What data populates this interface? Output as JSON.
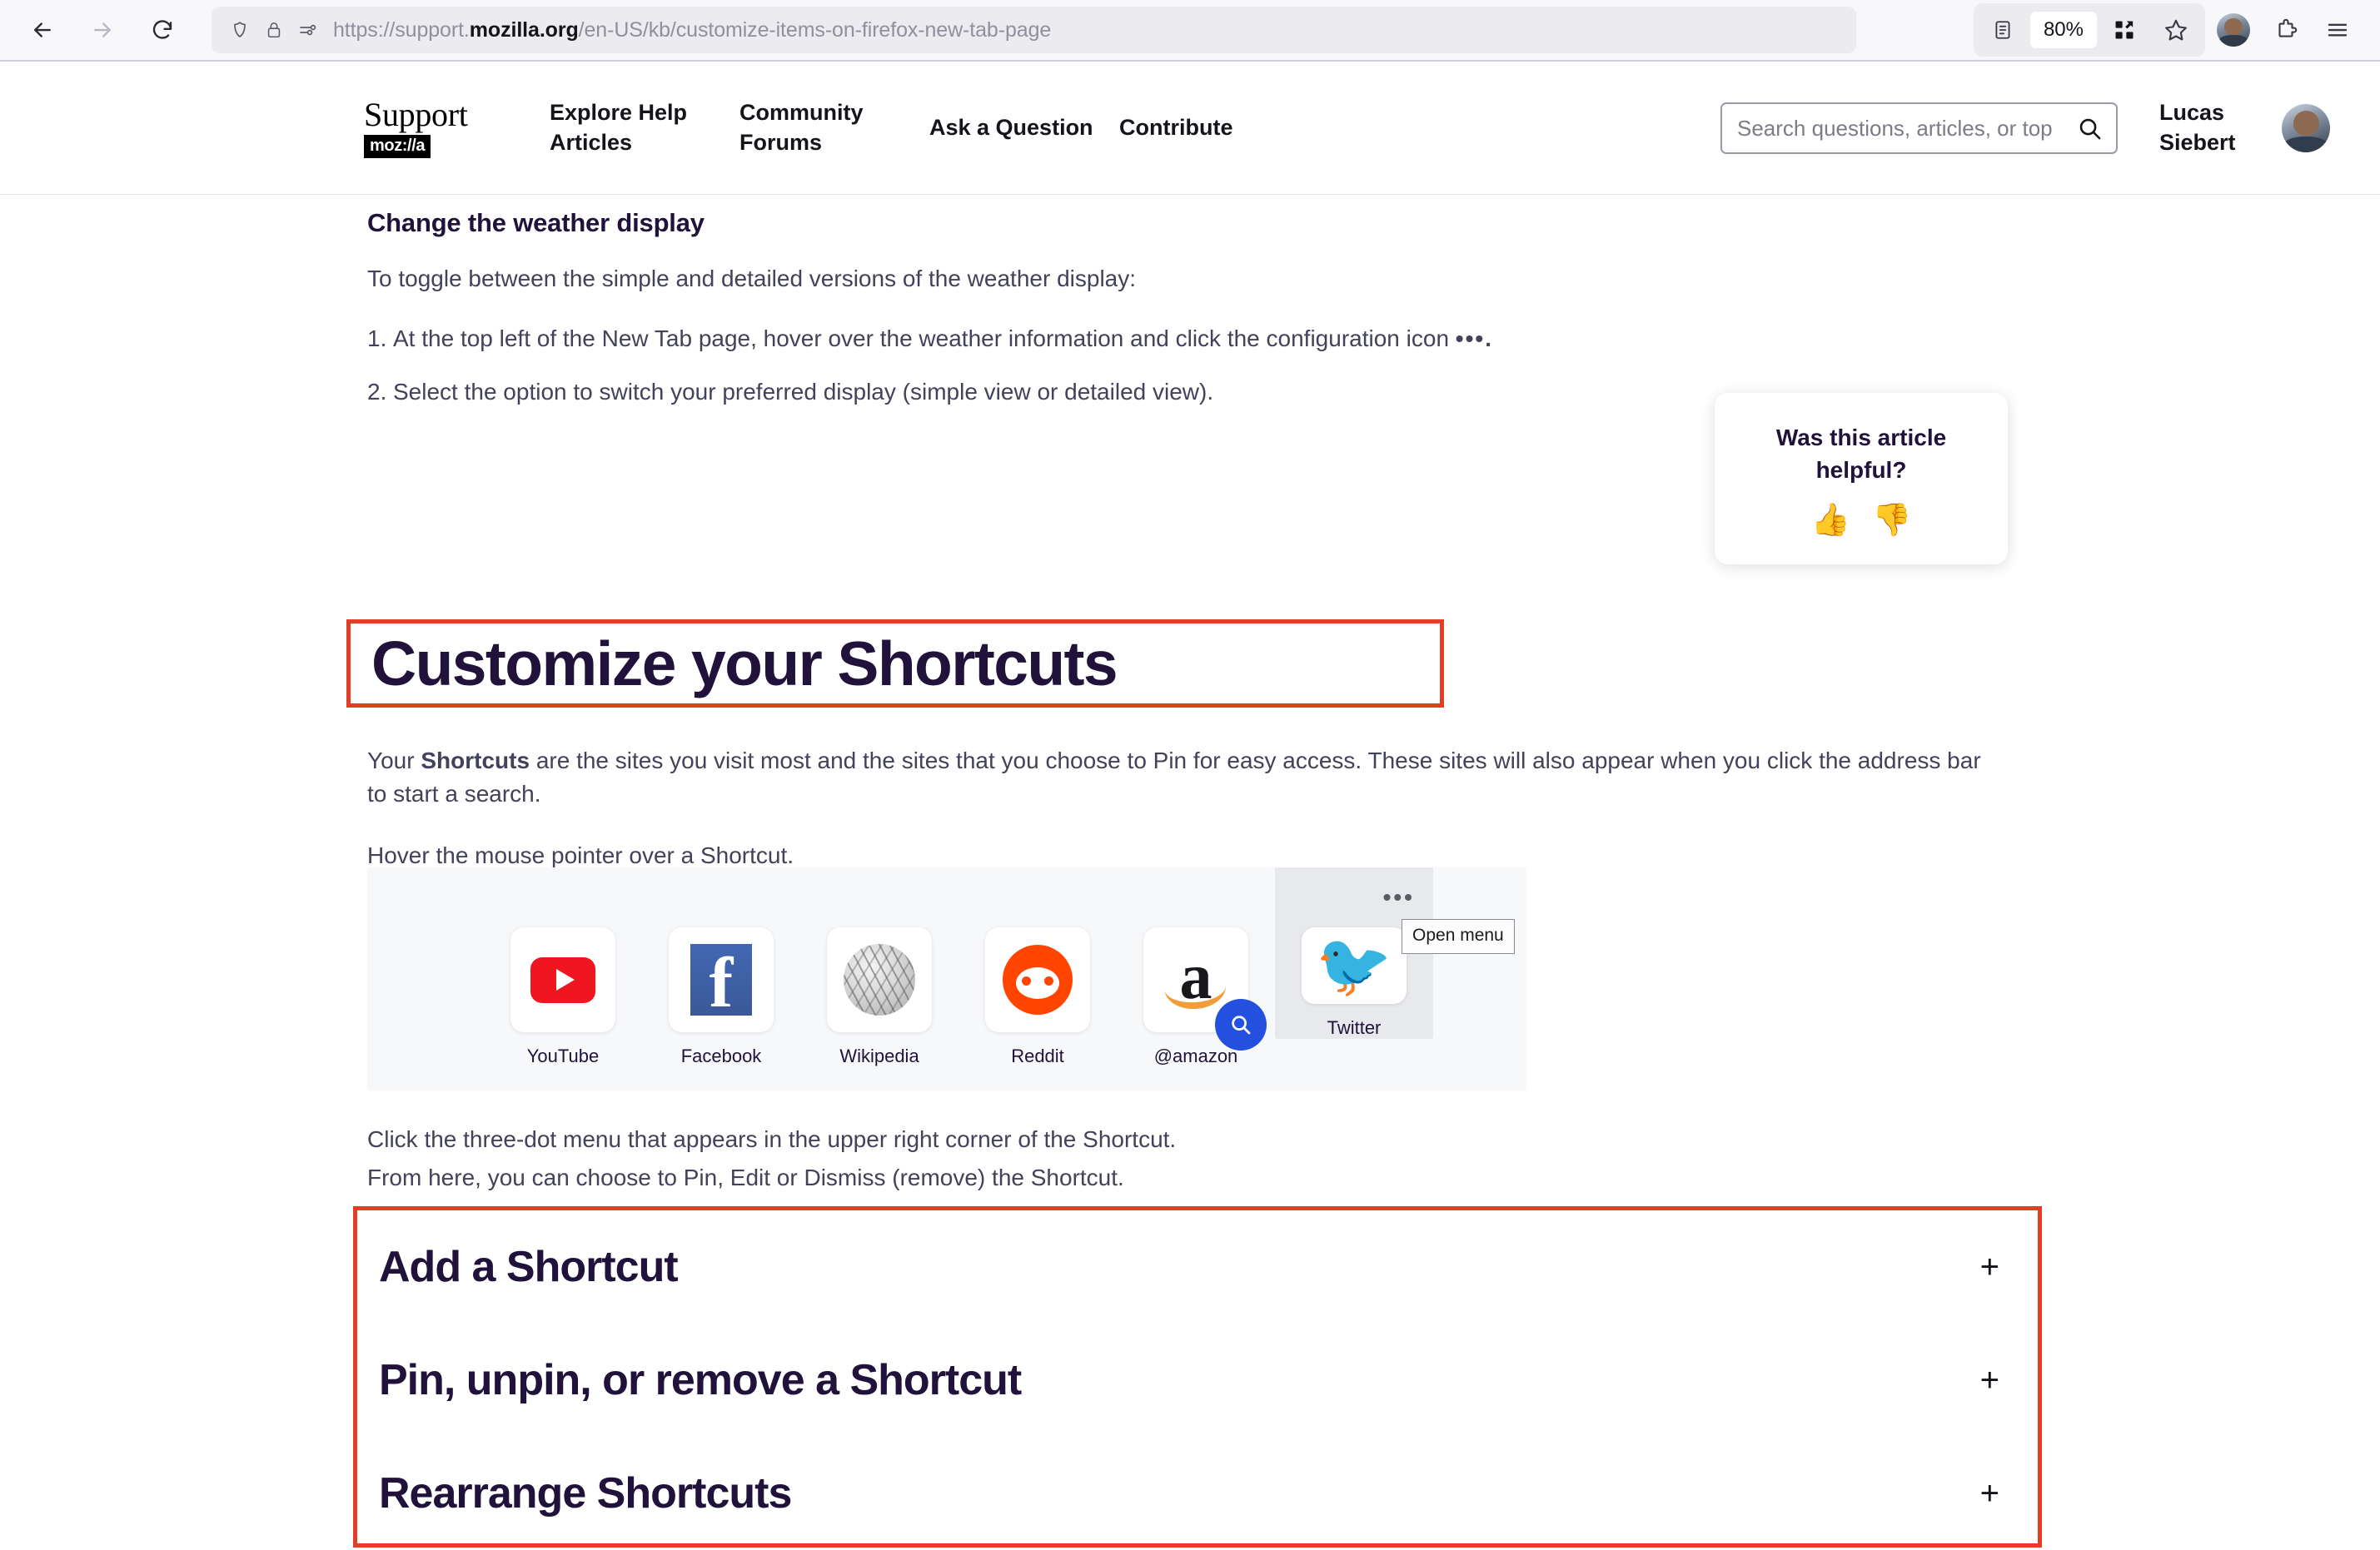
{
  "browser": {
    "back_icon": "back-arrow-icon",
    "forward_icon": "forward-arrow-icon",
    "reload_icon": "reload-icon",
    "url_prefix": "https://support.",
    "url_domain": "mozilla.org",
    "url_path": "/en-US/kb/customize-items-on-firefox-new-tab-page",
    "zoom_level": "80%",
    "icons": {
      "shield": "shield-icon",
      "lock": "padlock-icon",
      "permissions": "site-permissions-icon",
      "reader": "reader-view-icon",
      "extensions_overflow": "extensions-overflow-icon",
      "bookmark": "bookmark-star-icon",
      "account": "firefox-account-avatar",
      "puzzle": "extensions-puzzle-icon",
      "menu": "hamburger-menu-icon"
    }
  },
  "site_header": {
    "logo_word": "Support",
    "logo_badge": "moz://a",
    "nav": [
      {
        "label": "Explore Help Articles"
      },
      {
        "label": "Community Forums"
      },
      {
        "label": "Ask a Question"
      },
      {
        "label": "Contribute"
      }
    ],
    "search": {
      "placeholder": "Search questions, articles, or top",
      "value": "",
      "icon": "search-icon"
    },
    "user_name": "Lucas Siebert",
    "avatar": "user-avatar"
  },
  "article": {
    "section_heading": "Change the weather display",
    "intro": "To toggle between the simple and detailed versions of the weather display:",
    "steps": [
      {
        "num": "1.",
        "text": "At the top left of the New Tab page, hover over the weather information and click the configuration icon",
        "trailing": "•••."
      },
      {
        "num": "2.",
        "text": "Select the option to switch your preferred display (simple view or detailed view).",
        "trailing": ""
      }
    ],
    "main_heading": "Customize your Shortcuts",
    "paragraph_lead": "Your ",
    "paragraph_bold": "Shortcuts",
    "paragraph_rest": " are the sites you visit most and the sites that you choose to Pin for easy access. These sites will also appear when you click the address bar to start a search.",
    "hover_line": "Hover the mouse pointer over a Shortcut.",
    "after_lines": [
      "Click the three-dot menu that appears in the upper right corner of the Shortcut.",
      "From here, you can choose to Pin, Edit or Dismiss (remove) the Shortcut."
    ]
  },
  "shortcuts_figure": {
    "tooltip": "Open menu",
    "menu_dots": "•••",
    "tiles": [
      {
        "label": "YouTube",
        "icon": "youtube-icon"
      },
      {
        "label": "Facebook",
        "icon": "facebook-icon"
      },
      {
        "label": "Wikipedia",
        "icon": "wikipedia-icon"
      },
      {
        "label": "Reddit",
        "icon": "reddit-icon"
      },
      {
        "label": "@amazon",
        "icon": "amazon-icon"
      },
      {
        "label": "Twitter",
        "icon": "twitter-icon"
      }
    ]
  },
  "helpful_card": {
    "title": "Was this article helpful?",
    "thumbs_up": "👍",
    "thumbs_down": "👎"
  },
  "accordion": {
    "items": [
      {
        "title": "Add a Shortcut",
        "toggle": "+"
      },
      {
        "title": "Pin, unpin, or remove a Shortcut",
        "toggle": "+"
      },
      {
        "title": "Rearrange Shortcuts",
        "toggle": "+"
      }
    ]
  },
  "colors": {
    "annotation_red": "#e43d25",
    "heading_navy": "#20123a",
    "body_text": "#42425a",
    "accent_blue": "#2450e0"
  }
}
